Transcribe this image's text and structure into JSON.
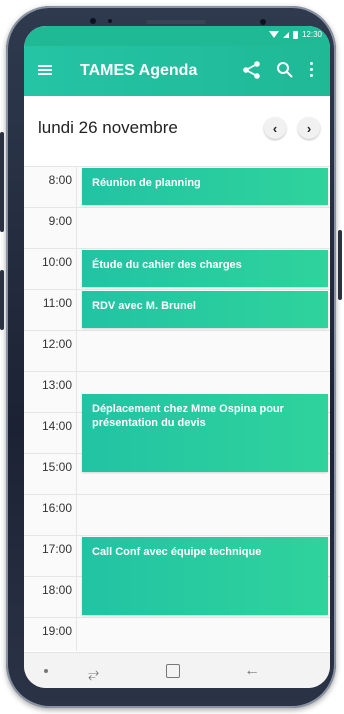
{
  "status_bar": {
    "time": "12:30"
  },
  "app_bar": {
    "title": "TAMES Agenda",
    "icons": [
      "menu-icon",
      "share-icon",
      "search-icon",
      "more-vertical-icon"
    ]
  },
  "date_row": {
    "date": "lundi 26 novembre",
    "prev_label": "‹",
    "next_label": "›"
  },
  "calendar": {
    "hours": [
      "8:00",
      "9:00",
      "10:00",
      "11:00",
      "12:00",
      "13:00",
      "14:00",
      "15:00",
      "16:00",
      "17:00",
      "18:00",
      "19:00"
    ],
    "events": [
      {
        "title": "Réunion de planning",
        "start": "8:00",
        "end": "9:00"
      },
      {
        "title": "Étude du cahier des charges",
        "start": "10:00",
        "end": "11:00"
      },
      {
        "title": "RDV avec M. Brunel",
        "start": "11:00",
        "end": "12:00"
      },
      {
        "title": "Déplacement chez Mme Ospina pour présentation du devis",
        "start": "13:30",
        "end": "15:30"
      },
      {
        "title": "Call Conf avec équipe technique",
        "start": "17:00",
        "end": "19:00"
      }
    ]
  },
  "colors": {
    "accent": "#1fb996",
    "event": "#2fd39b"
  }
}
